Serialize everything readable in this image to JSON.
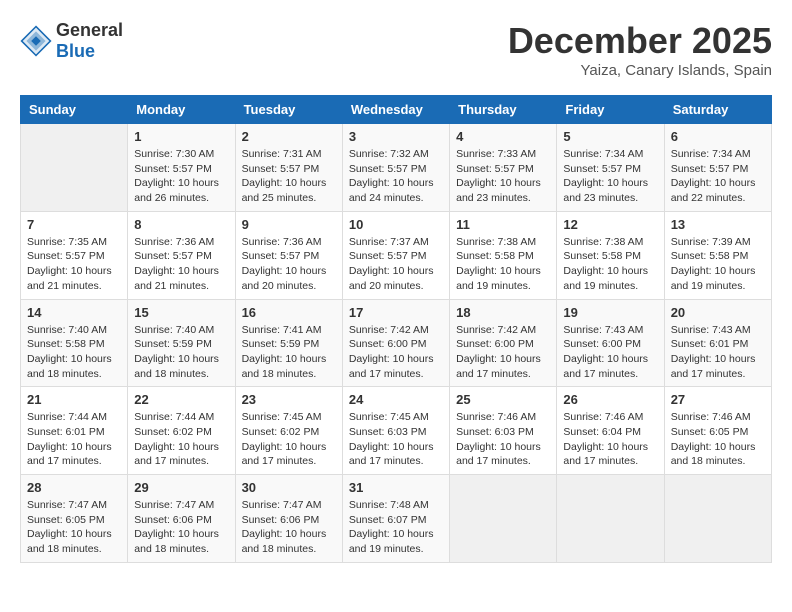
{
  "header": {
    "logo_general": "General",
    "logo_blue": "Blue",
    "month_title": "December 2025",
    "location": "Yaiza, Canary Islands, Spain"
  },
  "weekdays": [
    "Sunday",
    "Monday",
    "Tuesday",
    "Wednesday",
    "Thursday",
    "Friday",
    "Saturday"
  ],
  "weeks": [
    [
      {
        "day": "",
        "info": ""
      },
      {
        "day": "1",
        "info": "Sunrise: 7:30 AM\nSunset: 5:57 PM\nDaylight: 10 hours\nand 26 minutes."
      },
      {
        "day": "2",
        "info": "Sunrise: 7:31 AM\nSunset: 5:57 PM\nDaylight: 10 hours\nand 25 minutes."
      },
      {
        "day": "3",
        "info": "Sunrise: 7:32 AM\nSunset: 5:57 PM\nDaylight: 10 hours\nand 24 minutes."
      },
      {
        "day": "4",
        "info": "Sunrise: 7:33 AM\nSunset: 5:57 PM\nDaylight: 10 hours\nand 23 minutes."
      },
      {
        "day": "5",
        "info": "Sunrise: 7:34 AM\nSunset: 5:57 PM\nDaylight: 10 hours\nand 23 minutes."
      },
      {
        "day": "6",
        "info": "Sunrise: 7:34 AM\nSunset: 5:57 PM\nDaylight: 10 hours\nand 22 minutes."
      }
    ],
    [
      {
        "day": "7",
        "info": "Sunrise: 7:35 AM\nSunset: 5:57 PM\nDaylight: 10 hours\nand 21 minutes."
      },
      {
        "day": "8",
        "info": "Sunrise: 7:36 AM\nSunset: 5:57 PM\nDaylight: 10 hours\nand 21 minutes."
      },
      {
        "day": "9",
        "info": "Sunrise: 7:36 AM\nSunset: 5:57 PM\nDaylight: 10 hours\nand 20 minutes."
      },
      {
        "day": "10",
        "info": "Sunrise: 7:37 AM\nSunset: 5:57 PM\nDaylight: 10 hours\nand 20 minutes."
      },
      {
        "day": "11",
        "info": "Sunrise: 7:38 AM\nSunset: 5:58 PM\nDaylight: 10 hours\nand 19 minutes."
      },
      {
        "day": "12",
        "info": "Sunrise: 7:38 AM\nSunset: 5:58 PM\nDaylight: 10 hours\nand 19 minutes."
      },
      {
        "day": "13",
        "info": "Sunrise: 7:39 AM\nSunset: 5:58 PM\nDaylight: 10 hours\nand 19 minutes."
      }
    ],
    [
      {
        "day": "14",
        "info": "Sunrise: 7:40 AM\nSunset: 5:58 PM\nDaylight: 10 hours\nand 18 minutes."
      },
      {
        "day": "15",
        "info": "Sunrise: 7:40 AM\nSunset: 5:59 PM\nDaylight: 10 hours\nand 18 minutes."
      },
      {
        "day": "16",
        "info": "Sunrise: 7:41 AM\nSunset: 5:59 PM\nDaylight: 10 hours\nand 18 minutes."
      },
      {
        "day": "17",
        "info": "Sunrise: 7:42 AM\nSunset: 6:00 PM\nDaylight: 10 hours\nand 17 minutes."
      },
      {
        "day": "18",
        "info": "Sunrise: 7:42 AM\nSunset: 6:00 PM\nDaylight: 10 hours\nand 17 minutes."
      },
      {
        "day": "19",
        "info": "Sunrise: 7:43 AM\nSunset: 6:00 PM\nDaylight: 10 hours\nand 17 minutes."
      },
      {
        "day": "20",
        "info": "Sunrise: 7:43 AM\nSunset: 6:01 PM\nDaylight: 10 hours\nand 17 minutes."
      }
    ],
    [
      {
        "day": "21",
        "info": "Sunrise: 7:44 AM\nSunset: 6:01 PM\nDaylight: 10 hours\nand 17 minutes."
      },
      {
        "day": "22",
        "info": "Sunrise: 7:44 AM\nSunset: 6:02 PM\nDaylight: 10 hours\nand 17 minutes."
      },
      {
        "day": "23",
        "info": "Sunrise: 7:45 AM\nSunset: 6:02 PM\nDaylight: 10 hours\nand 17 minutes."
      },
      {
        "day": "24",
        "info": "Sunrise: 7:45 AM\nSunset: 6:03 PM\nDaylight: 10 hours\nand 17 minutes."
      },
      {
        "day": "25",
        "info": "Sunrise: 7:46 AM\nSunset: 6:03 PM\nDaylight: 10 hours\nand 17 minutes."
      },
      {
        "day": "26",
        "info": "Sunrise: 7:46 AM\nSunset: 6:04 PM\nDaylight: 10 hours\nand 17 minutes."
      },
      {
        "day": "27",
        "info": "Sunrise: 7:46 AM\nSunset: 6:05 PM\nDaylight: 10 hours\nand 18 minutes."
      }
    ],
    [
      {
        "day": "28",
        "info": "Sunrise: 7:47 AM\nSunset: 6:05 PM\nDaylight: 10 hours\nand 18 minutes."
      },
      {
        "day": "29",
        "info": "Sunrise: 7:47 AM\nSunset: 6:06 PM\nDaylight: 10 hours\nand 18 minutes."
      },
      {
        "day": "30",
        "info": "Sunrise: 7:47 AM\nSunset: 6:06 PM\nDaylight: 10 hours\nand 18 minutes."
      },
      {
        "day": "31",
        "info": "Sunrise: 7:48 AM\nSunset: 6:07 PM\nDaylight: 10 hours\nand 19 minutes."
      },
      {
        "day": "",
        "info": ""
      },
      {
        "day": "",
        "info": ""
      },
      {
        "day": "",
        "info": ""
      }
    ]
  ]
}
